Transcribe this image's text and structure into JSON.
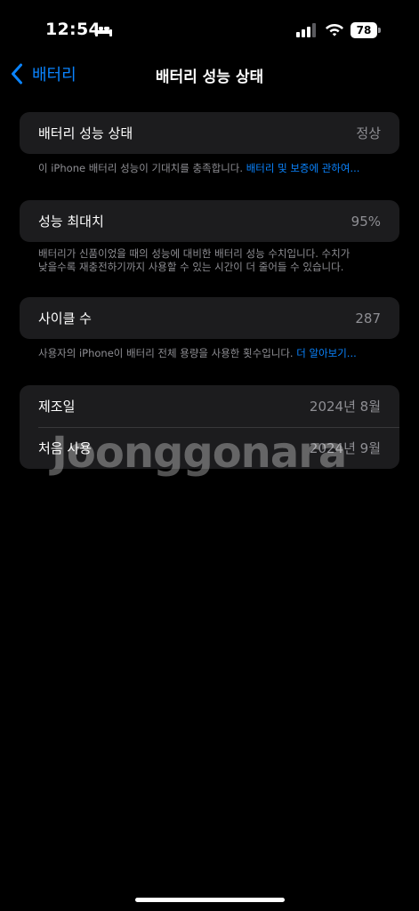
{
  "status_bar": {
    "time": "12:54",
    "battery_level": "78",
    "icons": [
      "sleep-bed-icon",
      "cellular-signal-icon",
      "wifi-icon",
      "battery-icon"
    ]
  },
  "nav": {
    "back_label": "배터리",
    "title": "배터리 성능 상태"
  },
  "sections": {
    "health": {
      "label": "배터리 성능 상태",
      "value": "정상",
      "footer_text": "이 iPhone 배터리 성능이 기대치를 충족합니다. ",
      "footer_link": "배터리 및 보증에 관하여..."
    },
    "max_capacity": {
      "label": "성능 최대치",
      "value": "95%",
      "footer_line1": "배터리가 신품이었을 때의 성능에 대비한 배터리 성능 수치입니다. 수치가",
      "footer_line2": "낮을수록 재충전하기까지 사용할 수 있는 시간이 더 줄어들 수 있습니다."
    },
    "cycle_count": {
      "label": "사이클 수",
      "value": "287",
      "footer_text": "사용자의 iPhone이 배터리 전체 용량을 사용한 횟수입니다. ",
      "footer_link": "더 알아보기..."
    },
    "dates": {
      "manufacture_label": "제조일",
      "manufacture_value": "2024년 8월",
      "first_use_label": "처음 사용",
      "first_use_value": "2024년 9월"
    }
  },
  "watermark": "Joonggonara",
  "colors": {
    "background": "#000000",
    "card": "#1c1c1e",
    "accent": "#0a84ff",
    "secondary_text": "#8e8e93"
  }
}
